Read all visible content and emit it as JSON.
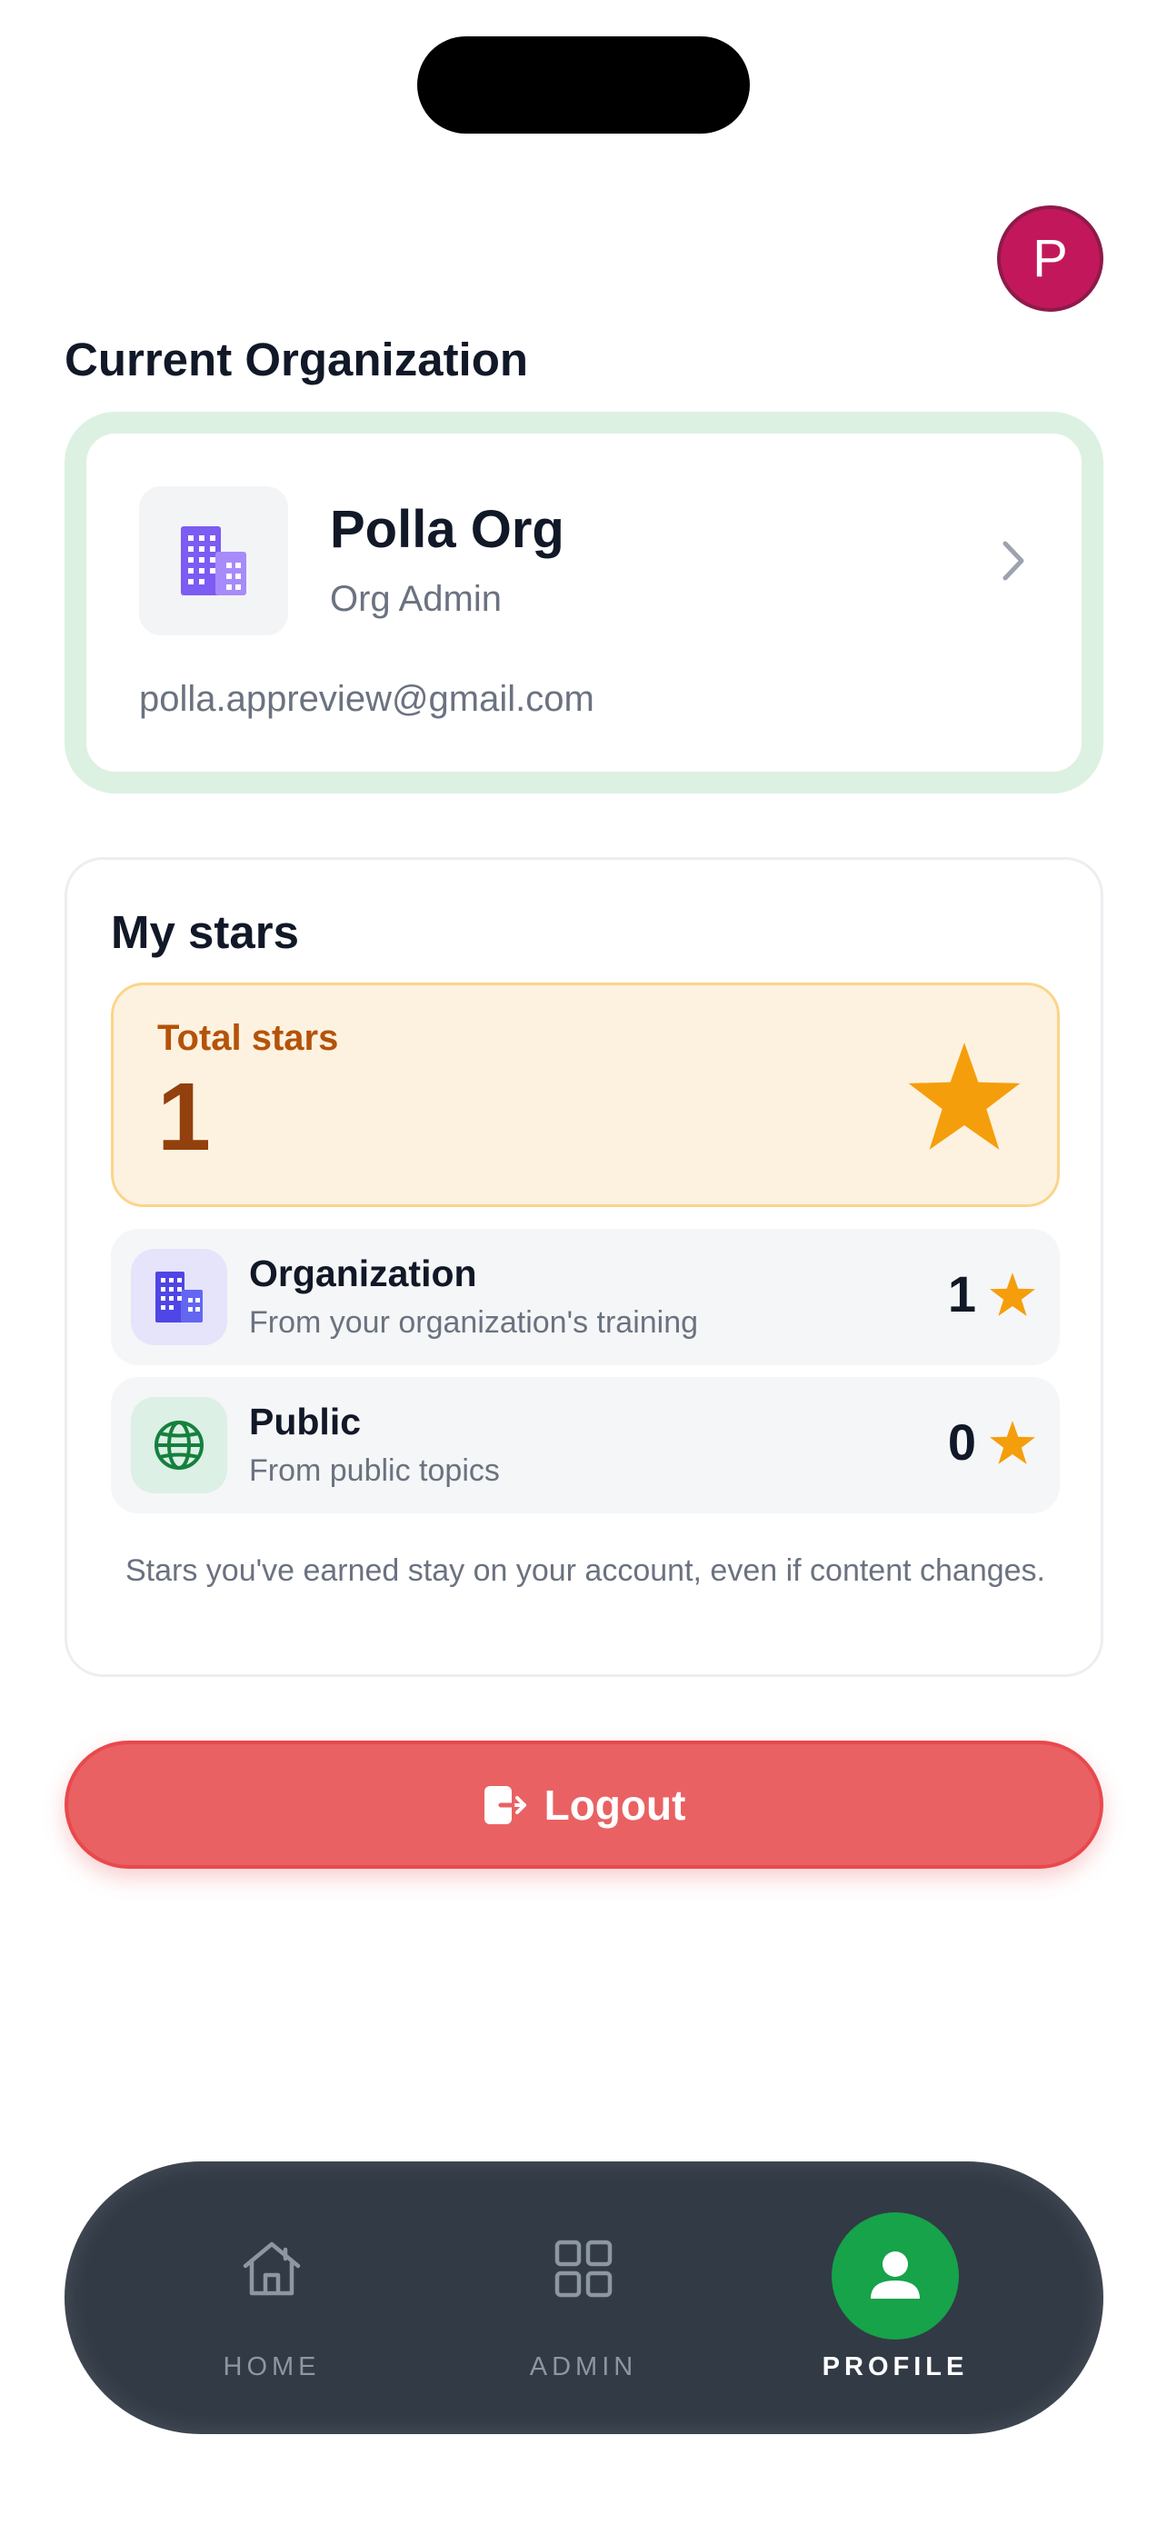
{
  "header": {
    "avatar_initial": "P",
    "avatar_color": "#c2185b"
  },
  "current_org": {
    "section_title": "Current Organization",
    "name": "Polla Org",
    "role": "Org Admin",
    "email": "polla.appreview@gmail.com",
    "icon": "building-icon",
    "accent": "#dcf1e2"
  },
  "stars": {
    "title": "My stars",
    "total_label": "Total stars",
    "total_value": "1",
    "rows": [
      {
        "title": "Organization",
        "subtitle": "From your organization's training",
        "count": "1",
        "icon": "building-icon"
      },
      {
        "title": "Public",
        "subtitle": "From public topics",
        "count": "0",
        "icon": "globe-icon"
      }
    ],
    "note": "Stars you've earned stay on your account, even if content changes.",
    "star_color": "#f59e0b"
  },
  "logout": {
    "label": "Logout",
    "icon": "logout-icon",
    "color": "#e96163"
  },
  "nav": {
    "items": [
      {
        "label": "HOME",
        "icon": "home-icon"
      },
      {
        "label": "ADMIN",
        "icon": "grid-icon"
      },
      {
        "label": "PROFILE",
        "icon": "user-icon",
        "active": true
      }
    ],
    "active_color": "#16a34a"
  }
}
